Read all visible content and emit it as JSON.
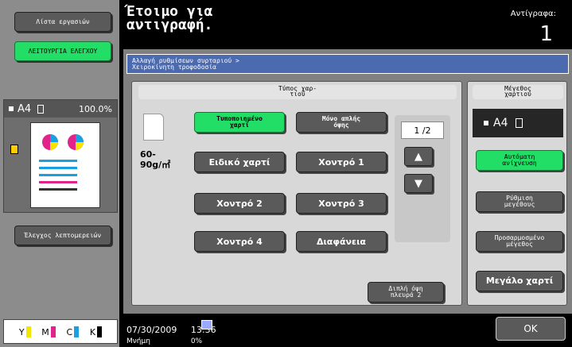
{
  "left_panel": {
    "job_list_label": "Λίστα εργασιών",
    "check_function_label": "ΛΕΙΤΟΥΡΓΙΑ ΕΛΕΓΧΟΥ",
    "preview": {
      "paper": "A4",
      "zoom": "100.0%"
    },
    "details_label": "Έλεγχος λεπτομερειών",
    "toner": [
      {
        "label": "Y",
        "color": "#f4e400"
      },
      {
        "label": "M",
        "color": "#e0248c"
      },
      {
        "label": "C",
        "color": "#1aa0e0"
      },
      {
        "label": "K",
        "color": "#000000"
      }
    ]
  },
  "header": {
    "status_line1": "Έτοιμο για",
    "status_line2": "αντιγραφή.",
    "copies_label": "Αντίγραφα:",
    "copies_value": "1"
  },
  "main": {
    "breadcrumb_line1": "Αλλαγή ρυθμίσεων συρταριού >",
    "breadcrumb_line2": "Χειροκίνητη τροφοδοσία",
    "paper_type": {
      "title_line1": "Τύπος χαρ-",
      "title_line2": "τιού",
      "weight_line1": "60-",
      "weight_line2": "90g/㎡",
      "buttons": [
        {
          "line1": "Τυποποιημένο",
          "line2": "χαρτί"
        },
        {
          "line1": "Μόνο απλής",
          "line2": "όψης"
        },
        {
          "label": "Ειδικό χαρτί"
        },
        {
          "label": "Χοντρό 1"
        },
        {
          "label": "Χοντρό 2"
        },
        {
          "label": "Χοντρό 3"
        },
        {
          "label": "Χοντρό 4"
        },
        {
          "label": "Διαφάνεια"
        }
      ],
      "page_indicator": "1 /2",
      "duplex_line1": "Διπλή όψη",
      "duplex_line2": "πλευρά 2"
    },
    "paper_size": {
      "title_line1": "Μέγεθος",
      "title_line2": "χαρτιού",
      "current": "A4",
      "auto_line1": "Αυτόματη",
      "auto_line2": "ανίχνευση",
      "adjust_line1": "Ρύθμιση",
      "adjust_line2": "μεγέθους",
      "custom_line1": "Προσαρμοσμένο",
      "custom_line2": "μέγεθος",
      "large_label": "Μεγάλο χαρτί"
    }
  },
  "footer": {
    "date": "07/30/2009",
    "time": "13:36",
    "memory_label": "Μνήμη",
    "memory_value": "0%",
    "ok_label": "OK"
  }
}
